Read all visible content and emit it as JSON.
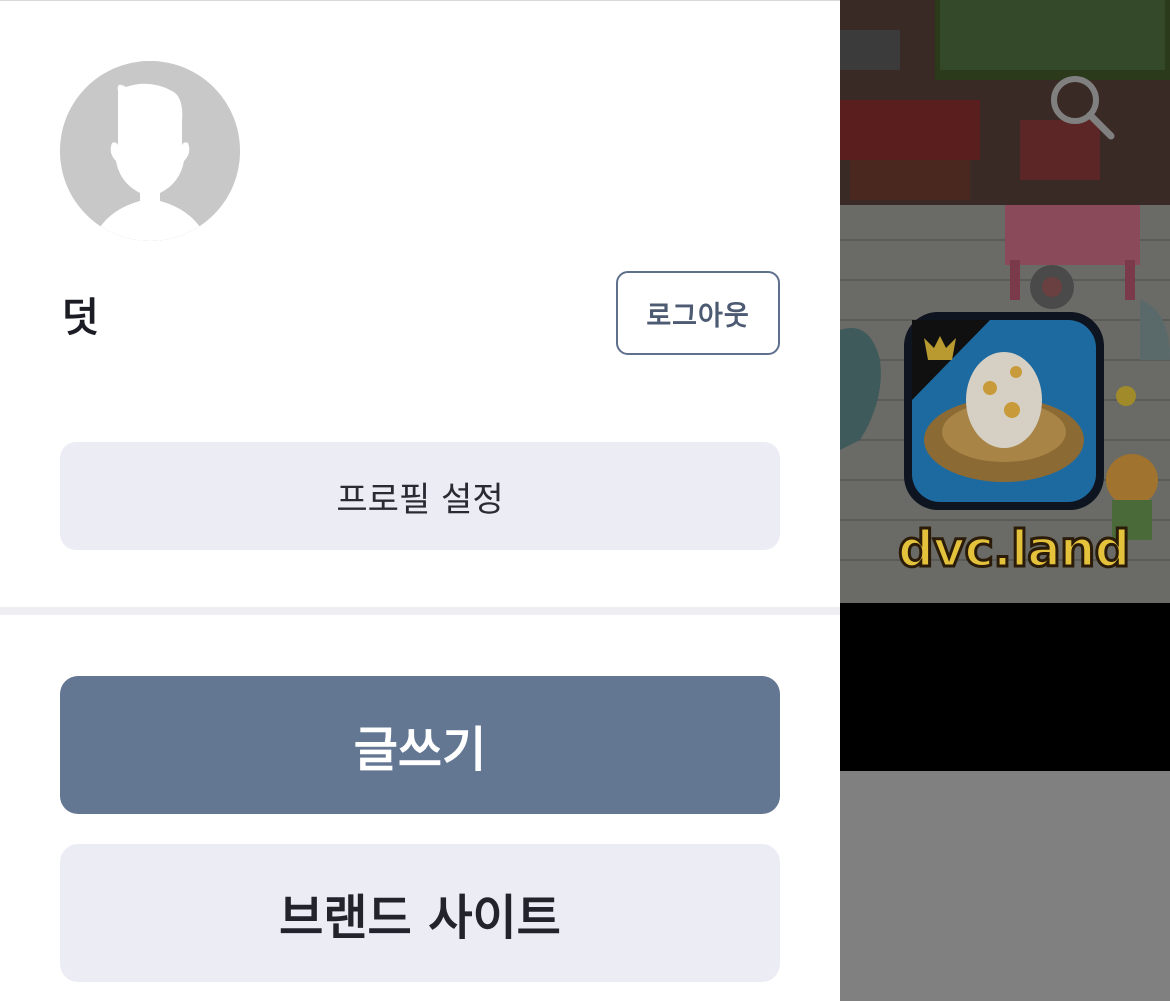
{
  "profile": {
    "username": "덧",
    "logout_label": "로그아웃",
    "settings_label": "프로필 설정"
  },
  "actions": {
    "write_label": "글쓰기",
    "brand_site_label": "브랜드 사이트"
  },
  "background": {
    "banner_text": "dvc.land",
    "search_icon": "search-icon"
  },
  "colors": {
    "primary": "#637793",
    "secondary_bg": "#ececf4",
    "outline": "#5e708c"
  }
}
